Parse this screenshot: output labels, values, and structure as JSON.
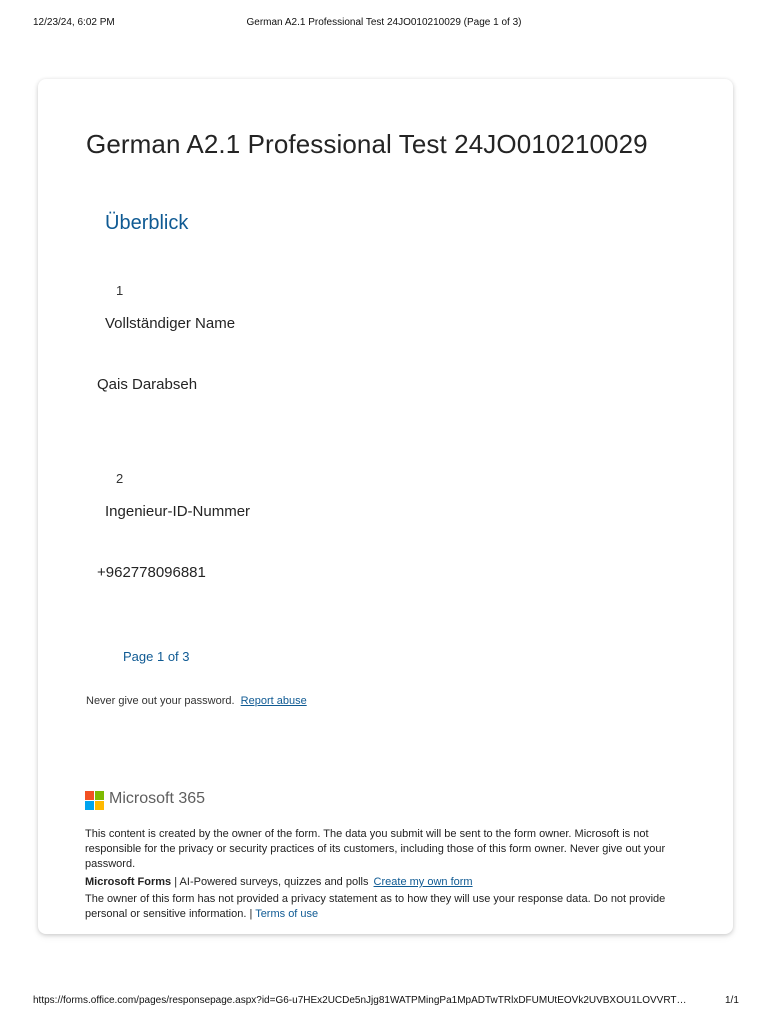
{
  "print_header": {
    "datetime": "12/23/24, 6:02 PM",
    "title": "German A2.1 Professional Test 24JO010210029 (Page 1 of 3)"
  },
  "form": {
    "title": "German A2.1 Professional Test 24JO010210029",
    "section_title": "Überblick",
    "questions": [
      {
        "number": "1",
        "label": "Vollständiger Name",
        "answer": "Qais Darabseh"
      },
      {
        "number": "2",
        "label": "Ingenieur-ID-Nummer",
        "answer": "+962778096881"
      }
    ],
    "page_indicator": "Page 1 of 3",
    "password_note": "Never give out your password.",
    "report_abuse_label": "Report abuse"
  },
  "footer": {
    "brand_name": "Microsoft 365",
    "logo_colors": [
      "#f25022",
      "#7fba00",
      "#00a4ef",
      "#ffb900"
    ],
    "disclaimer": "This content is created by the owner of the form. The data you submit will be sent to the form owner. Microsoft is not responsible for the privacy or security practices of its customers, including those of this form owner. Never give out your password.",
    "forms_brand": "Microsoft Forms",
    "forms_tagline": "| AI-Powered surveys, quizzes and polls",
    "create_form_label": "Create my own form",
    "privacy_note": "The owner of this form has not provided a privacy statement as to how they will use your response data. Do not provide personal or sensitive information. |",
    "terms_label": "Terms of use"
  },
  "print_footer": {
    "url": "https://forms.office.com/pages/responsepage.aspx?id=G6-u7HEx2UCDe5nJjg81WATPMingPa1MpADTwTRlxDFUMUtEOVk2UVBXOU1LOVVRT…",
    "pages": "1/1"
  },
  "colors": {
    "accent": "#0f5a93",
    "text": "#242424"
  }
}
